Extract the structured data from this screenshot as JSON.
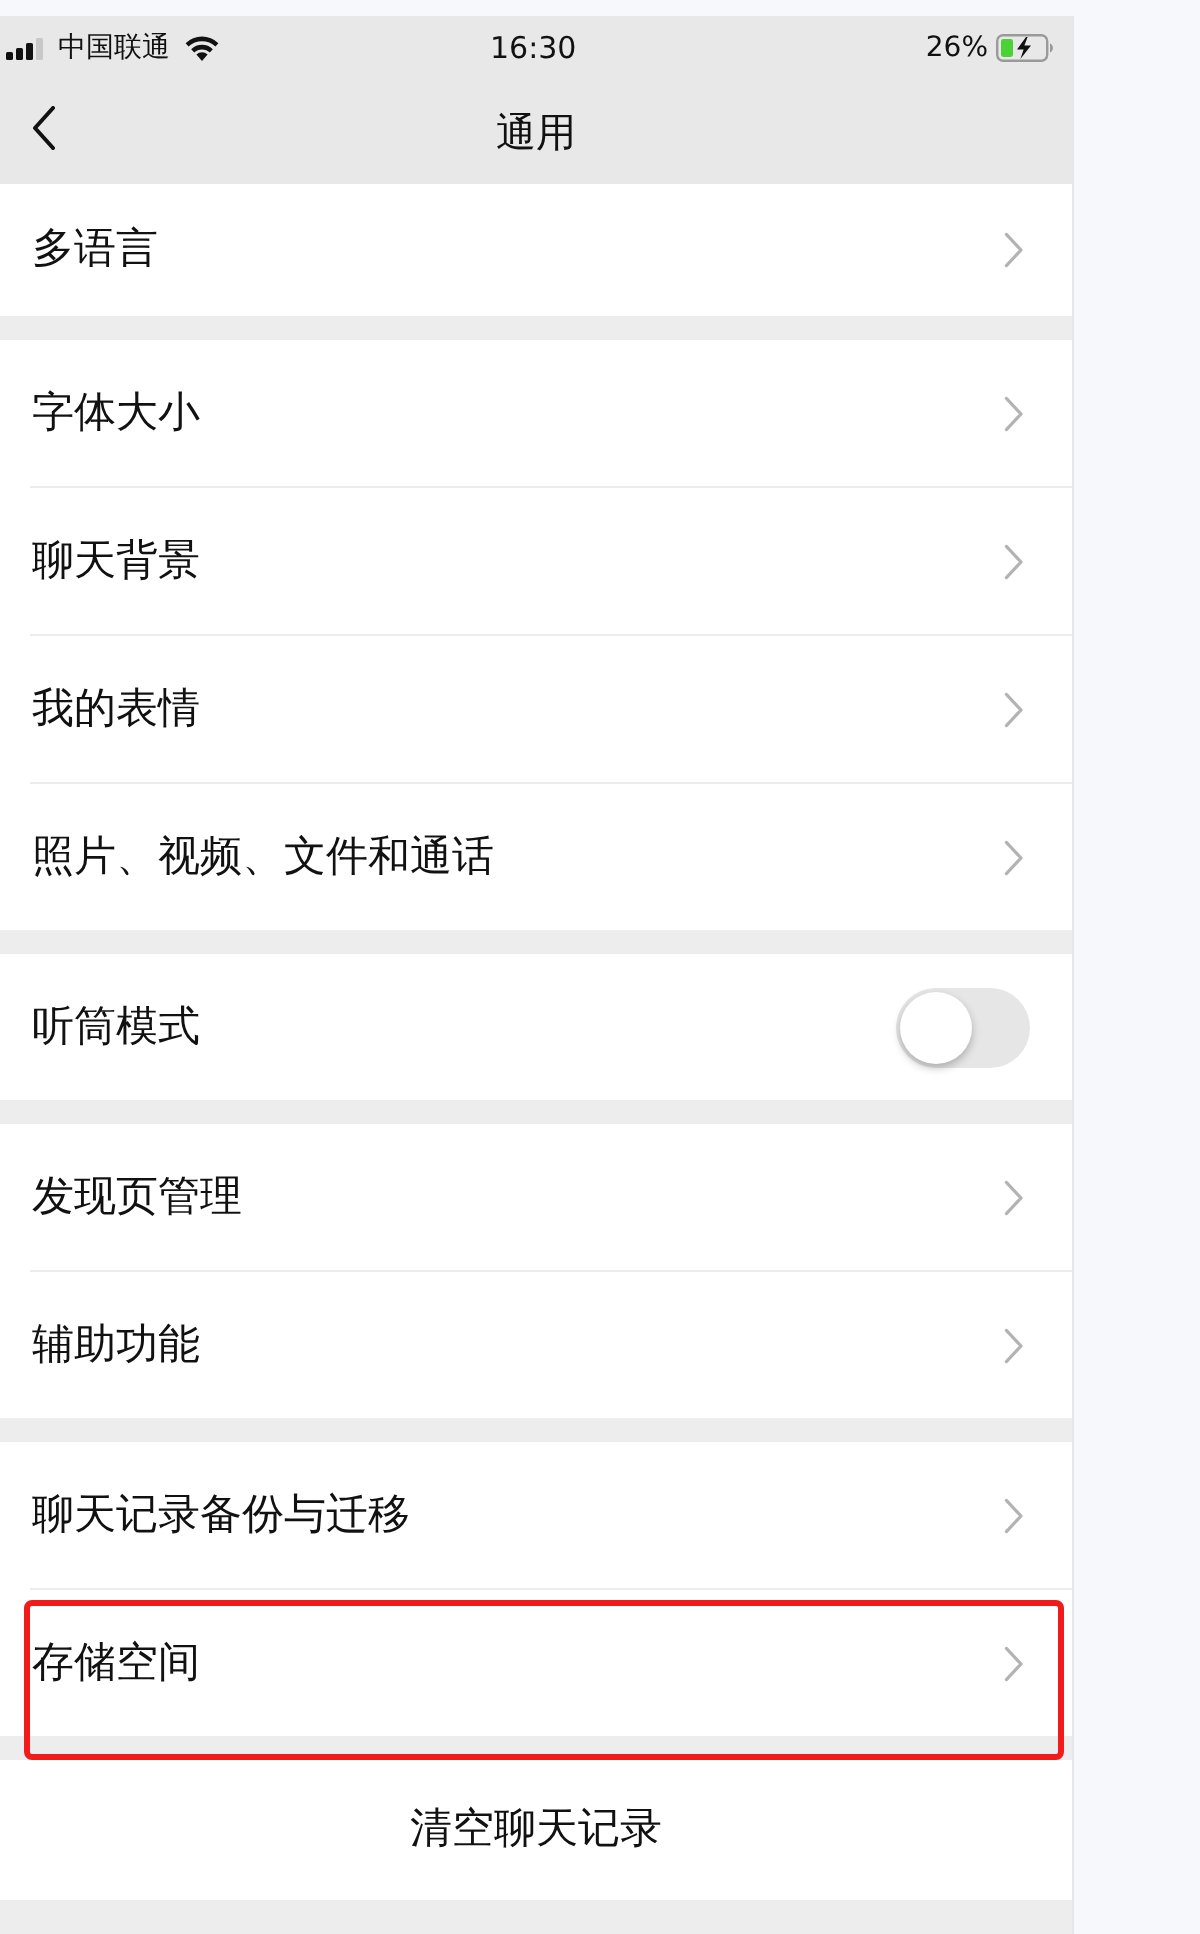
{
  "status_bar": {
    "carrier": "中国联通",
    "time": "16:30",
    "battery": "26%"
  },
  "nav_bar": {
    "title": "通用"
  },
  "groups": [
    {
      "items": [
        {
          "kind": "link",
          "label": "多语言",
          "highlighted": false
        }
      ]
    },
    {
      "items": [
        {
          "kind": "link",
          "label": "字体大小",
          "highlighted": false
        },
        {
          "kind": "link",
          "label": "聊天背景",
          "highlighted": false
        },
        {
          "kind": "link",
          "label": "我的表情",
          "highlighted": false
        },
        {
          "kind": "link",
          "label": "照片、视频、文件和通话",
          "highlighted": false
        }
      ]
    },
    {
      "items": [
        {
          "kind": "toggle",
          "label": "听筒模式",
          "on": false,
          "highlighted": false
        }
      ]
    },
    {
      "items": [
        {
          "kind": "link",
          "label": "发现页管理",
          "highlighted": false
        },
        {
          "kind": "link",
          "label": "辅助功能",
          "highlighted": false
        }
      ]
    },
    {
      "items": [
        {
          "kind": "link",
          "label": "聊天记录备份与迁移",
          "highlighted": false
        },
        {
          "kind": "link",
          "label": "存储空间",
          "highlighted": true
        }
      ]
    }
  ],
  "action": {
    "label": "清空聊天记录"
  }
}
